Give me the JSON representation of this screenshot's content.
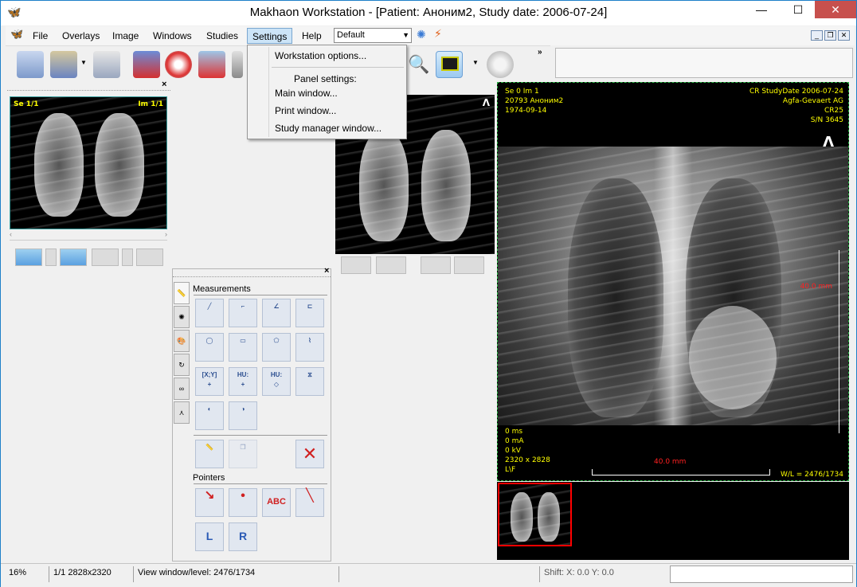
{
  "window": {
    "title": "Makhaon Workstation - [Patient: Аноним2, Study date: 2006-07-24]",
    "controls": {
      "minimize": "—",
      "maximize": "☐",
      "close": "✕"
    }
  },
  "menubar": {
    "items": [
      "File",
      "Overlays",
      "Image",
      "Windows",
      "Studies",
      "Settings",
      "Help"
    ],
    "active": "Settings",
    "preset_select_value": "Default"
  },
  "settings_menu": {
    "workstation_options": "Workstation options...",
    "panel_settings_header": "Panel settings:",
    "main_window": "Main window...",
    "print_window": "Print window...",
    "study_manager_window": "Study manager window..."
  },
  "left_panel": {
    "series_label": "Se 1/1",
    "image_label": "Im 1/1"
  },
  "middle_panel": {
    "orientation_marker": "Λ"
  },
  "tool_palette": {
    "measurements_title": "Measurements",
    "pointers_title": "Pointers",
    "xy_label": "[X;Y]",
    "hu_label": "HU:",
    "abc_label": "ABC",
    "l_label": "L",
    "r_label": "R"
  },
  "main_viewer": {
    "top_left": [
      "Se 0 Im 1",
      "20793 Аноним2",
      "1974-09-14"
    ],
    "top_right": [
      "CR StudyDate 2006-07-24",
      "Agfa-Gevaert AG",
      "CR25",
      "S/N 3645"
    ],
    "bottom_left": [
      "0 ms",
      "0 mA",
      "0 kV",
      "2320 x 2828",
      "L\\F"
    ],
    "bottom_right": "W/L = 2476/1734",
    "scale_vertical": "40.0 mm",
    "scale_horizontal": "40.0 mm",
    "orientation_marker": "Λ"
  },
  "statusbar": {
    "zoom": "16%",
    "image_info": "1/1 2828x2320",
    "window_level": "View window/level: 2476/1734",
    "shift": "Shift: X: 0.0 Y: 0.0"
  },
  "colors": {
    "overlay_text": "#ffff00",
    "measurement_red": "#ff2020",
    "active_frame": "#24b13f",
    "thumb_selected": "#ff0000",
    "menu_highlight": "#cce4f7"
  }
}
